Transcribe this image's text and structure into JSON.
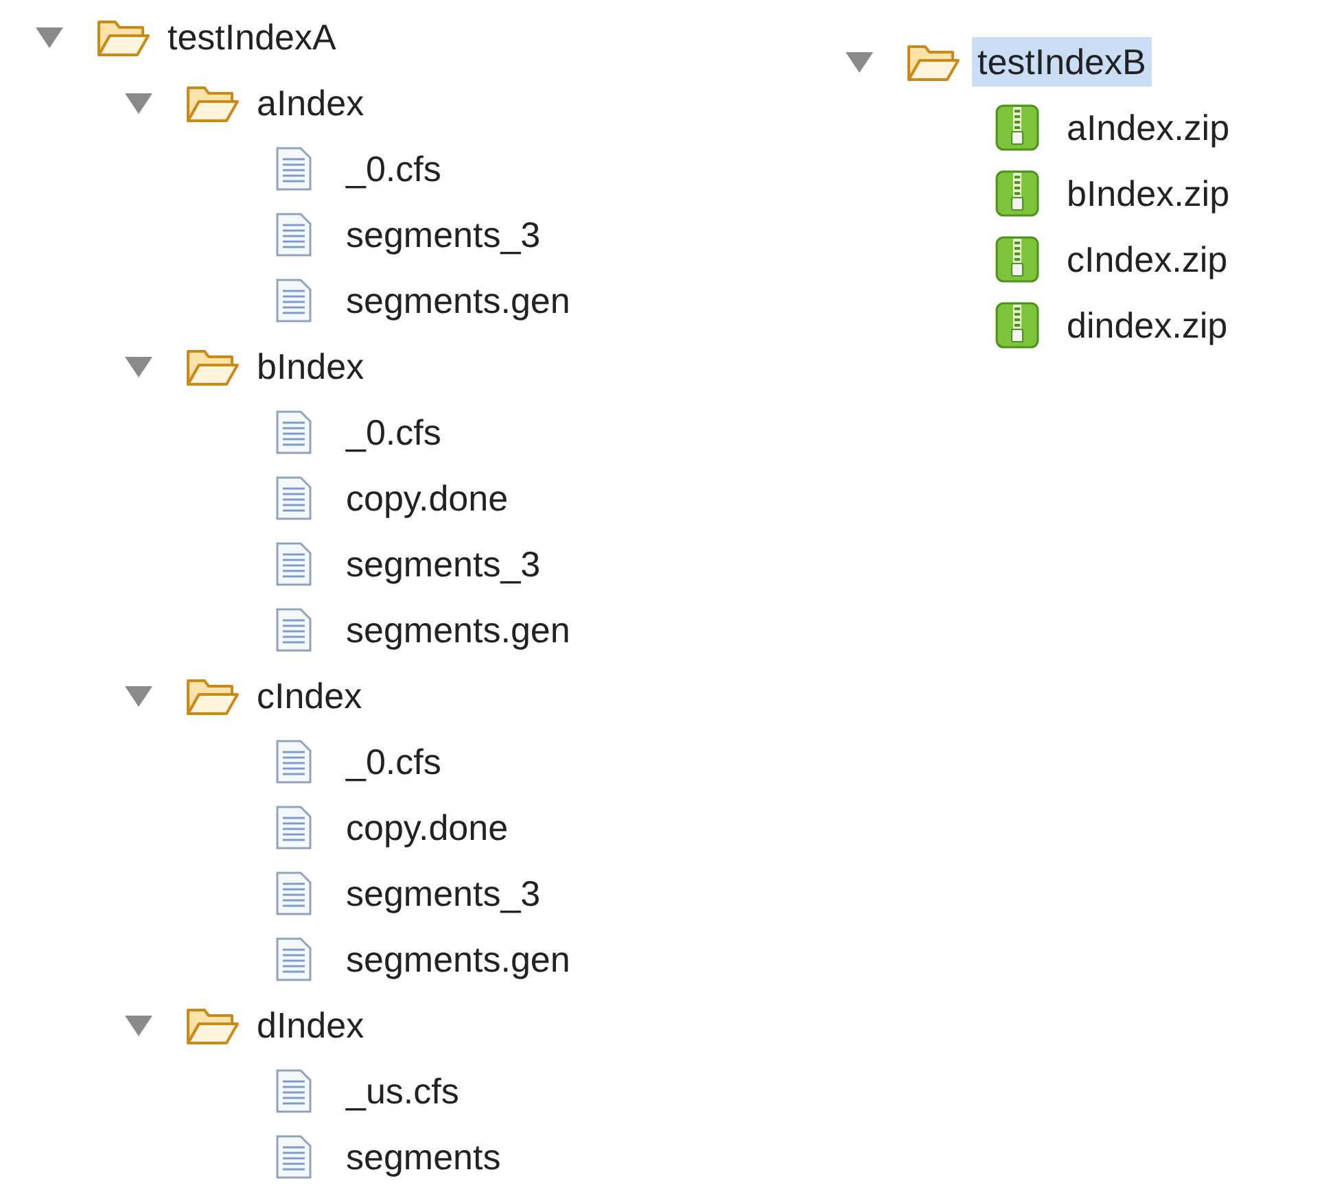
{
  "trees": [
    {
      "name": "testIndexA",
      "kind": "folder",
      "expanded": true,
      "selected": false,
      "children": [
        {
          "name": "aIndex",
          "kind": "folder",
          "expanded": true,
          "selected": false,
          "children": [
            {
              "name": "_0.cfs",
              "kind": "file",
              "selected": false
            },
            {
              "name": "segments_3",
              "kind": "file",
              "selected": false
            },
            {
              "name": "segments.gen",
              "kind": "file",
              "selected": false
            }
          ]
        },
        {
          "name": "bIndex",
          "kind": "folder",
          "expanded": true,
          "selected": false,
          "children": [
            {
              "name": "_0.cfs",
              "kind": "file",
              "selected": false
            },
            {
              "name": "copy.done",
              "kind": "file",
              "selected": false
            },
            {
              "name": "segments_3",
              "kind": "file",
              "selected": false
            },
            {
              "name": "segments.gen",
              "kind": "file",
              "selected": false
            }
          ]
        },
        {
          "name": "cIndex",
          "kind": "folder",
          "expanded": true,
          "selected": false,
          "children": [
            {
              "name": "_0.cfs",
              "kind": "file",
              "selected": false
            },
            {
              "name": "copy.done",
              "kind": "file",
              "selected": false
            },
            {
              "name": "segments_3",
              "kind": "file",
              "selected": false
            },
            {
              "name": "segments.gen",
              "kind": "file",
              "selected": false
            }
          ]
        },
        {
          "name": "dIndex",
          "kind": "folder",
          "expanded": true,
          "selected": false,
          "children": [
            {
              "name": "_us.cfs",
              "kind": "file",
              "selected": false
            },
            {
              "name": "segments",
              "kind": "file",
              "selected": false
            }
          ]
        }
      ]
    },
    {
      "name": "testIndexB",
      "kind": "folder",
      "expanded": true,
      "selected": true,
      "children": [
        {
          "name": "aIndex.zip",
          "kind": "zip",
          "selected": false
        },
        {
          "name": "bIndex.zip",
          "kind": "zip",
          "selected": false
        },
        {
          "name": "cIndex.zip",
          "kind": "zip",
          "selected": false
        },
        {
          "name": "dindex.zip",
          "kind": "zip",
          "selected": false
        }
      ]
    }
  ]
}
